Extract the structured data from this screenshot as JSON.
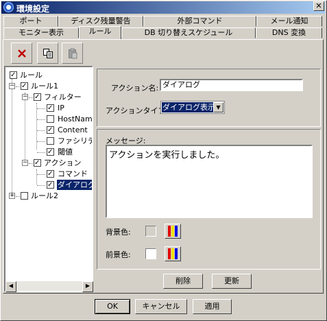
{
  "window": {
    "title": "環境設定",
    "close_glyph": "✕"
  },
  "tabs_row1": [
    "ポート",
    "ディスク残量警告",
    "外部コマンド",
    "メール通知"
  ],
  "tabs_row2": [
    "モニター表示",
    "ルール",
    "DB 切り替えスケジュール",
    "DNS 変換"
  ],
  "active_tab": "ルール",
  "toolbar": {
    "buttons": [
      "delete-icon",
      "copy-icon",
      "paste-icon"
    ]
  },
  "tree": {
    "root": "ルール",
    "rule1": "ルール1",
    "filter": "フィルター",
    "ip": "IP",
    "hostname": "HostNam",
    "content": "Content",
    "facility": "ファシリティ",
    "threshold": "閾値",
    "action": "アクション",
    "command": "コマンド",
    "dialog": "ダイアログ",
    "rule2": "ルール2"
  },
  "action": {
    "name_label": "アクション名:",
    "name_value": "ダイアログ",
    "type_label": "アクションタイプ:",
    "type_value": "ダイアログ表示"
  },
  "message": {
    "label": "メッセージ:",
    "value": "アクションを実行しました。"
  },
  "colors": {
    "bg_label": "背景色:",
    "fg_label": "前景色:",
    "bg_swatch": "#d4d0c8",
    "fg_swatch": "#ffffff"
  },
  "panel_buttons": {
    "delete": "削除",
    "update": "更新"
  },
  "dialog_buttons": {
    "ok": "OK",
    "cancel": "キャンセル",
    "apply": "適用"
  }
}
